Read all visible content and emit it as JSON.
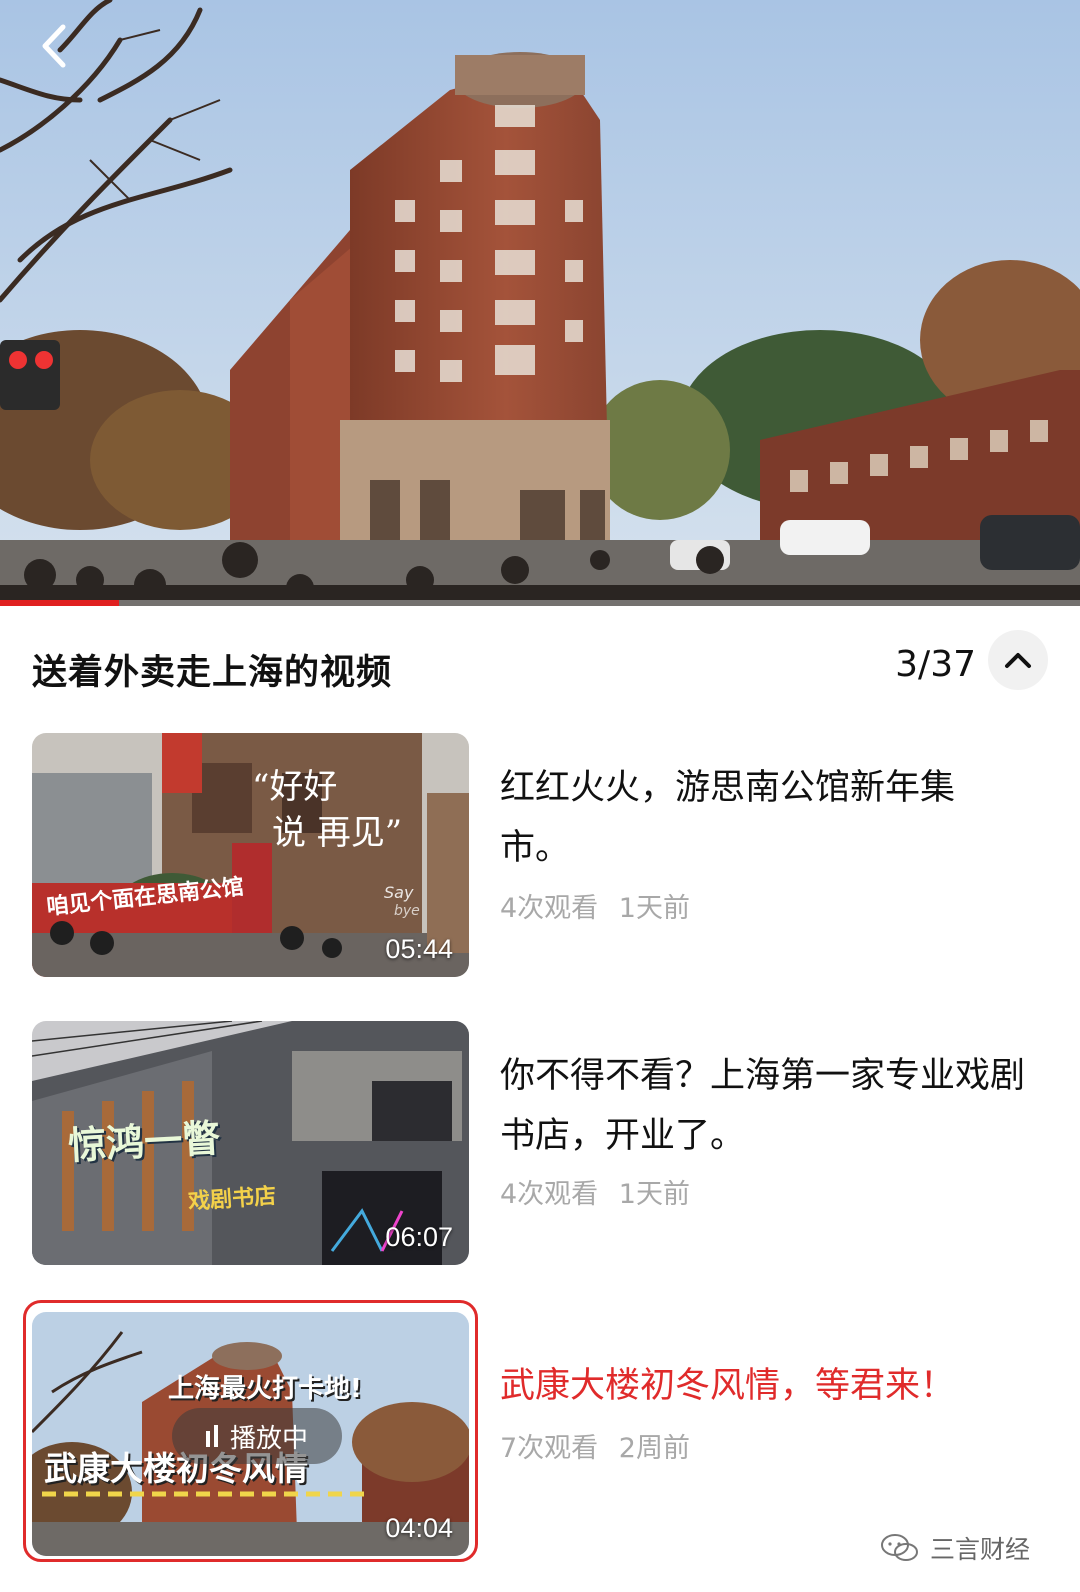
{
  "hero": {
    "video_progress": 0.11,
    "back_icon": "chevron-left-icon"
  },
  "playlist": {
    "title": "送着外卖走上海的视频",
    "position": "3/37",
    "collapse_icon": "chevron-up-icon"
  },
  "items": [
    {
      "title": "红红火火，游思南公馆新年集市。",
      "views": "4次观看",
      "age": "1天前",
      "duration": "05:44",
      "thumb_text": [
        "“好好",
        "说 再见”",
        "咱见个面在思南公馆",
        "Say",
        "bye"
      ],
      "playing": false
    },
    {
      "title": "你不得不看？上海第一家专业戏剧书店，开业了。",
      "views": "4次观看",
      "age": "1天前",
      "duration": "06:07",
      "thumb_text": [
        "惊鸿一瞥",
        "戏剧书店"
      ],
      "playing": false
    },
    {
      "title": "武康大楼初冬风情，等君来！",
      "views": "7次观看",
      "age": "2周前",
      "duration": "04:04",
      "thumb_text": [
        "上海最火打卡地!",
        "武康大楼初冬风情"
      ],
      "playing": true,
      "playing_label": "播放中"
    }
  ],
  "watermark": {
    "text": "三言财经",
    "icon": "wechat-icon"
  },
  "colors": {
    "accent": "#e02b2b",
    "meta_text": "#a8a8a8",
    "sky": "#b9cfe6",
    "brick": "#9a4a32"
  }
}
